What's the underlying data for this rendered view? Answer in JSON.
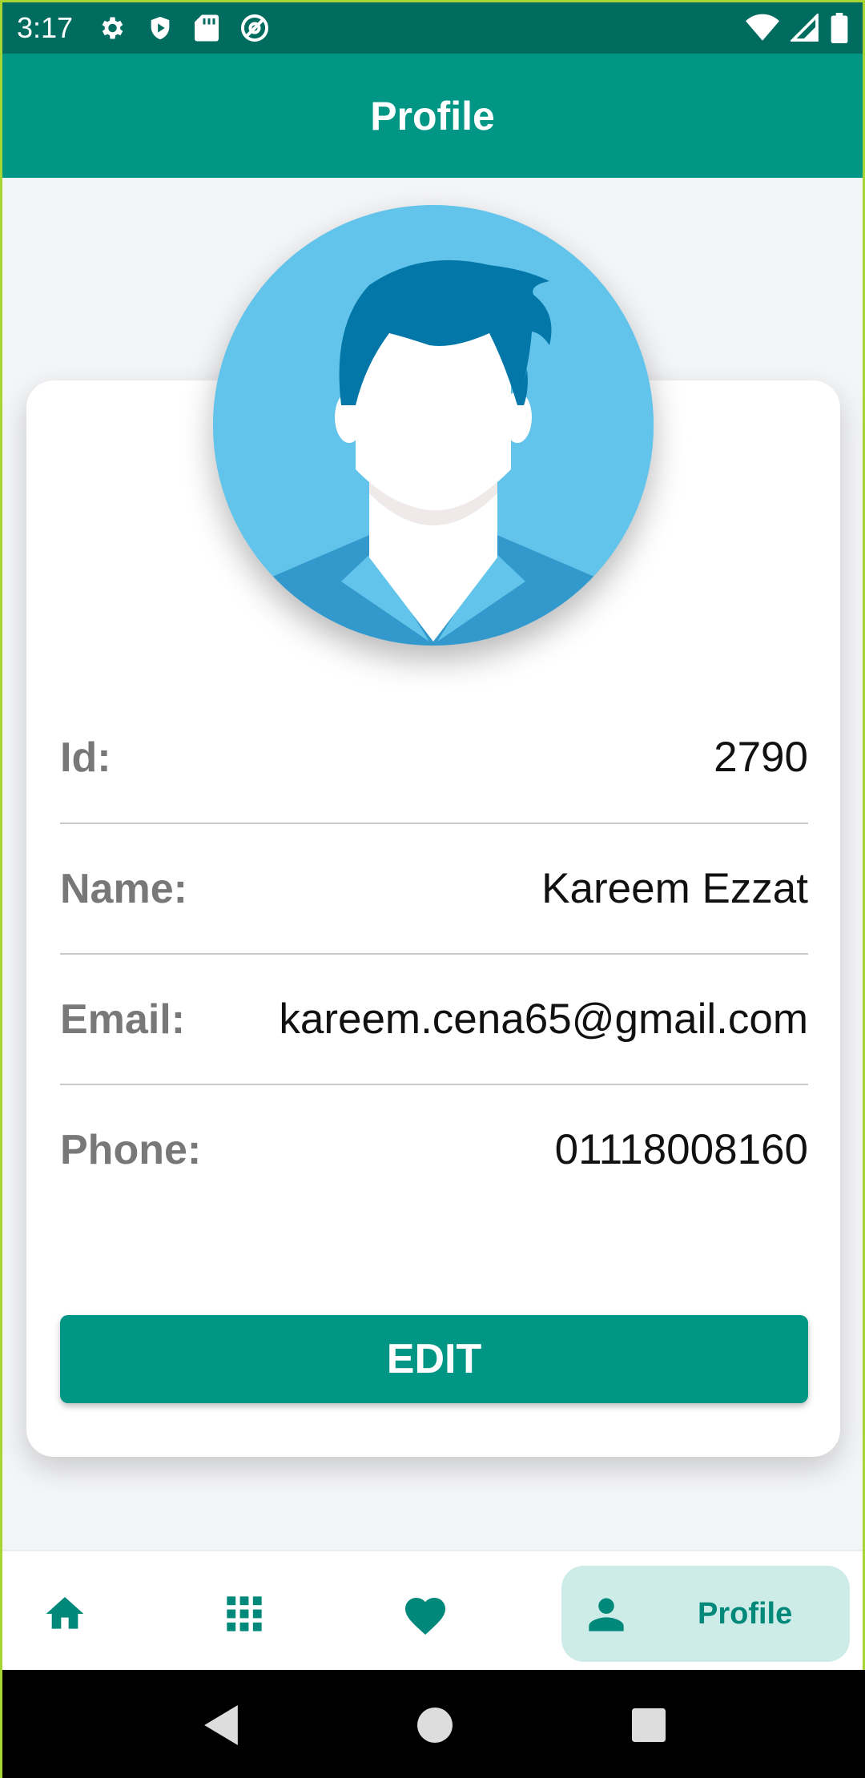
{
  "status_bar": {
    "time": "3:17",
    "left_icons": [
      "settings-icon",
      "shield-play-icon",
      "sd-card-icon",
      "at-sign-icon"
    ],
    "right_icons": [
      "wifi-icon",
      "cell-signal-icon",
      "battery-icon"
    ]
  },
  "app_bar": {
    "title": "Profile"
  },
  "profile": {
    "avatar": "default-male-avatar",
    "fields": [
      {
        "label": "Id:",
        "value": "2790"
      },
      {
        "label": "Name:",
        "value": "Kareem Ezzat"
      },
      {
        "label": "Email:",
        "value": "kareem.cena65@gmail.com"
      },
      {
        "label": "Phone:",
        "value": "01118008160"
      }
    ],
    "edit_label": "EDIT"
  },
  "bottom_nav": {
    "items": [
      {
        "icon": "home-icon",
        "label": ""
      },
      {
        "icon": "grid-icon",
        "label": ""
      },
      {
        "icon": "heart-icon",
        "label": ""
      },
      {
        "icon": "person-icon",
        "label": "Profile",
        "selected": true
      }
    ]
  },
  "colors": {
    "primary": "#009685",
    "primary_dark": "#006b5f",
    "selected_tab_bg": "#cdebe7",
    "avatar_bg": "#62c4ea"
  }
}
